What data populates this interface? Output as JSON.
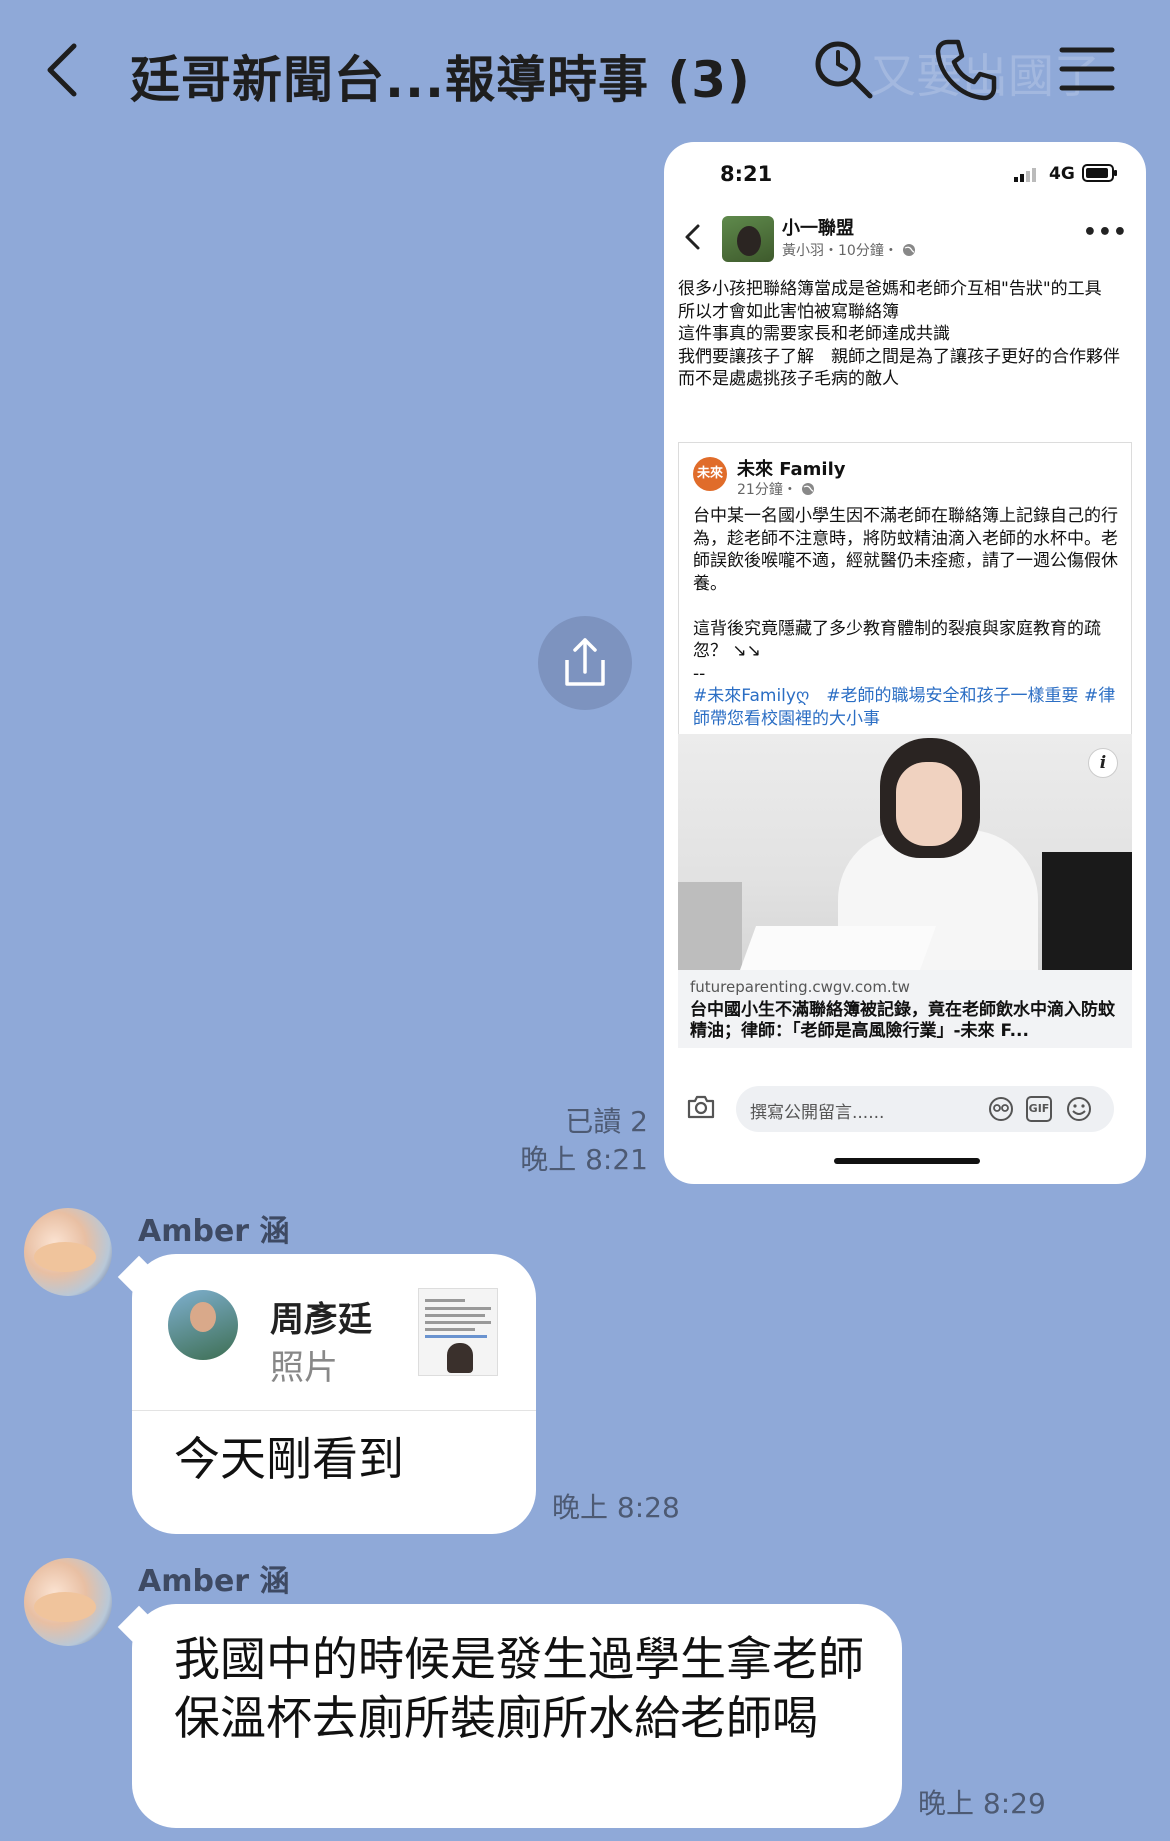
{
  "header": {
    "title": "廷哥新聞台...報導時事 (3)",
    "ghost_text": "又要出國了"
  },
  "screenshot": {
    "status_time": "8:21",
    "network": "4G",
    "post": {
      "author": "小一聯盟",
      "meta": "黃小羽・10分鐘・",
      "lines": [
        "很多小孩把聯絡簿當成是爸媽和老師介互相\"告狀\"的工具",
        "所以才會如此害怕被寫聯絡簿",
        "這件事真的需要家長和老師達成共識",
        "我們要讓孩子了解　親師之間是為了讓孩子更好的合作夥伴",
        "而不是處處挑孩子毛病的敵人"
      ]
    },
    "shared": {
      "logo_text": "未來",
      "name": "未來 Family",
      "meta": "21分鐘・",
      "lines": [
        "台中某一名國小學生因不滿老師在聯絡簿上記錄自己的行為，趁老師不注意時，將防蚊精油滴入老師的水杯中。老師誤飲後喉嚨不適，經就醫仍未痊癒，請了一週公傷假休養。",
        "",
        "這背後究竟隱藏了多少教育體制的裂痕與家庭教育的疏忽？ ↘↘",
        "--"
      ],
      "tags": "#未來Familyღ　#老師的職場安全和孩子一樣重要 #律師帶您看校園裡的大小事"
    },
    "photo_info": "i",
    "link": {
      "url": "futureparenting.cwgv.com.tw",
      "title": "台中國小生不滿聯絡簿被記錄，竟在老師飲水中滴入防蚊精油；律師：「老師是高風險行業」-未來 F..."
    },
    "comment_placeholder": "撰寫公開留言......",
    "gif_label": "GIF"
  },
  "my_message": {
    "read": "已讀 2",
    "time": "晚上 8:21"
  },
  "messages": [
    {
      "sender": "Amber 涵",
      "reply_name": "周彥廷",
      "reply_type": "照片",
      "text": "今天剛看到",
      "time": "晚上 8:28"
    },
    {
      "sender": "Amber 涵",
      "text": "我國中的時候是發生過學生拿老師保溫杯去廁所裝廁所水給老師喝",
      "time": "晚上 8:29"
    }
  ],
  "colors": {
    "background": "#8fa9d8",
    "link_blue": "#2b6ec4"
  }
}
